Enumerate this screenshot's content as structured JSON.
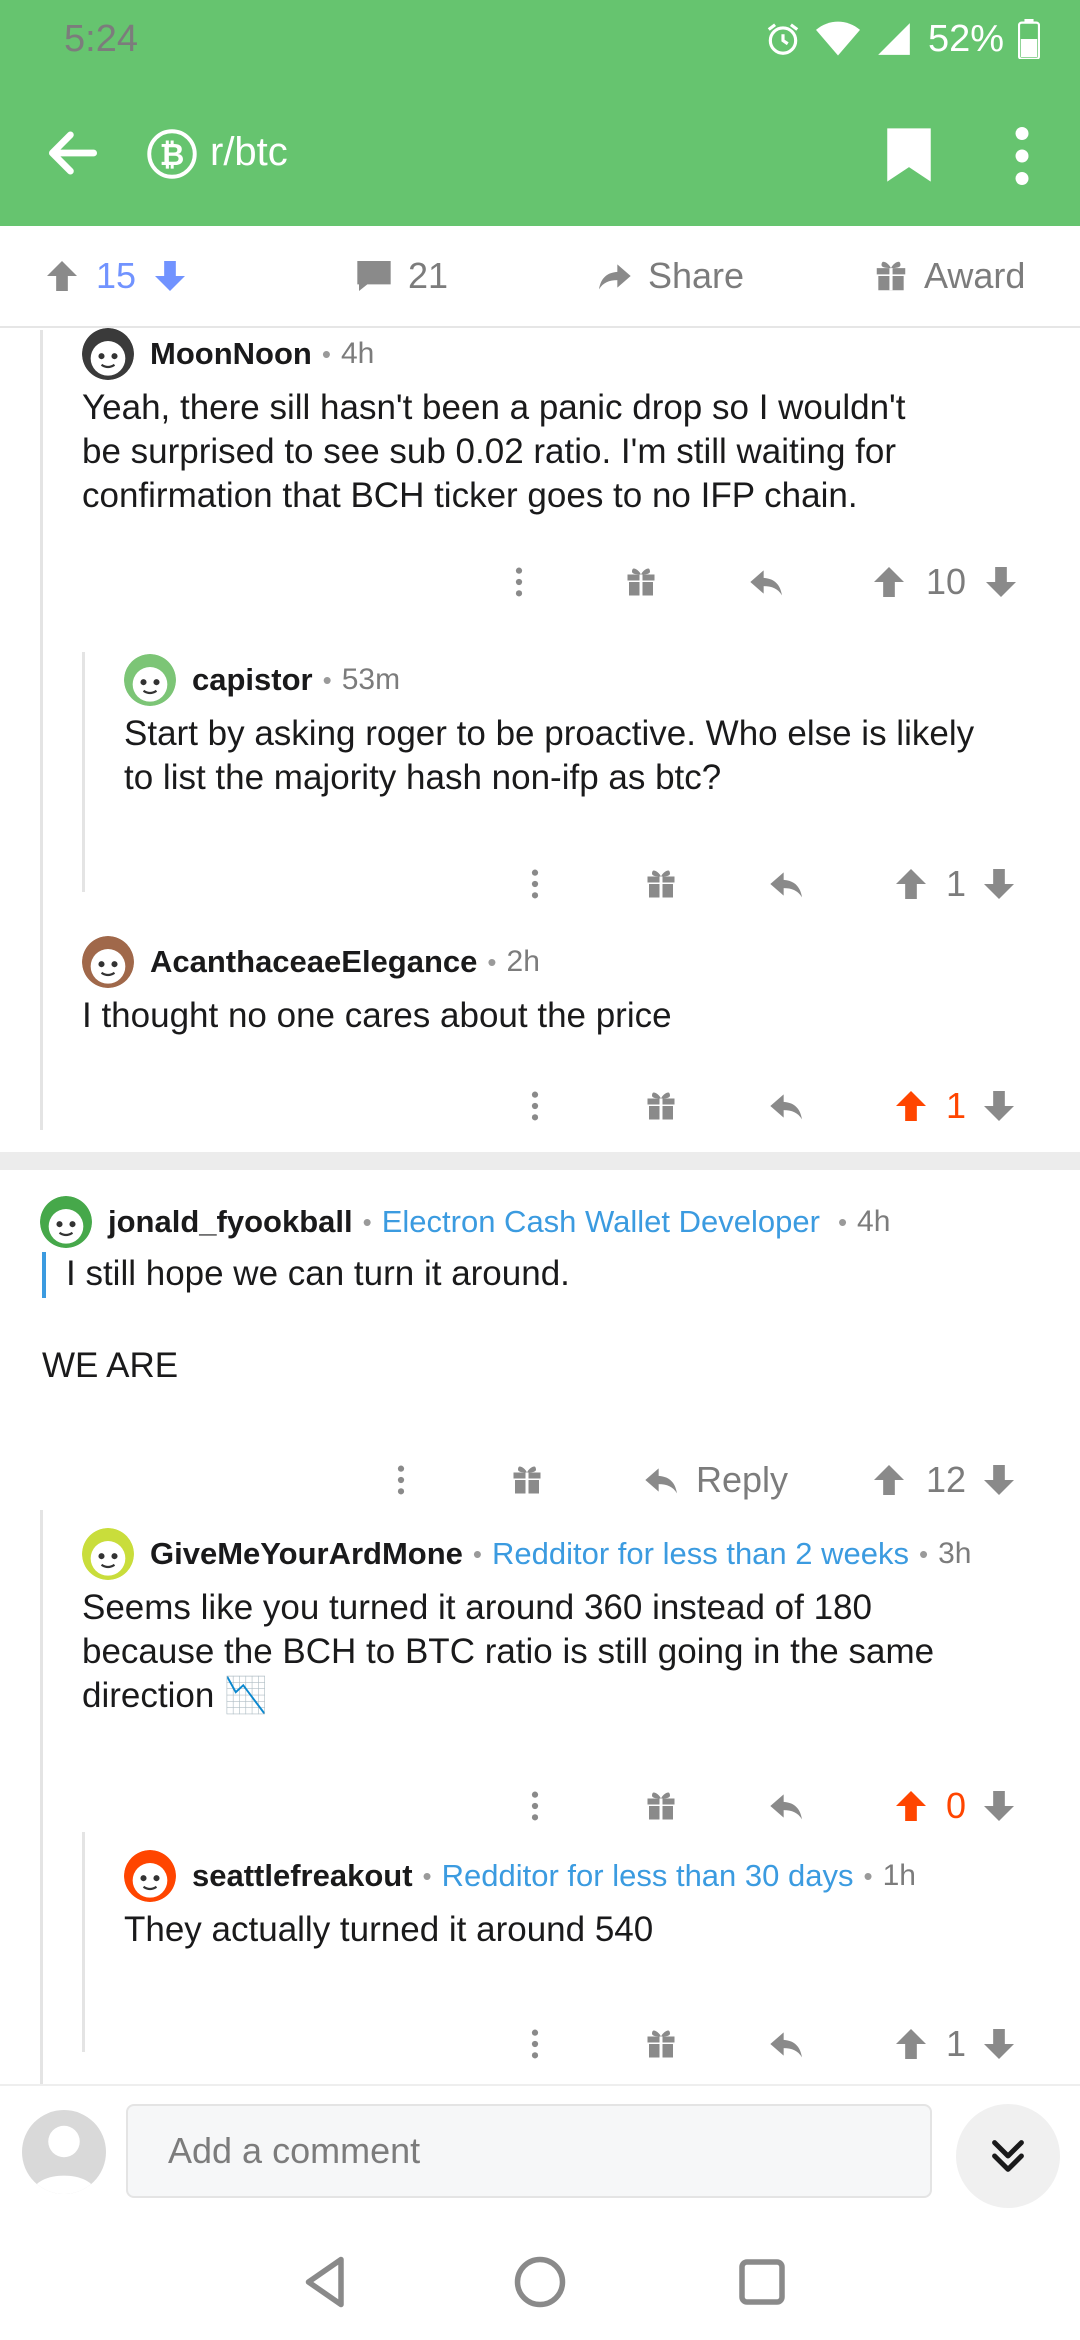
{
  "status_bar": {
    "time": "5:24",
    "battery": "52%"
  },
  "app_bar": {
    "title": "r/btc"
  },
  "post_actions": {
    "score": "15",
    "comments": "21",
    "share_label": "Share",
    "award_label": "Award"
  },
  "comments": [
    {
      "author": "MoonNoon",
      "time": "4h",
      "lines": [
        "Yeah, there sill hasn't been a panic drop so I wouldn't",
        "be surprised to see sub 0.02 ratio. I'm still waiting for",
        "confirmation that BCH ticker goes to no IFP chain."
      ],
      "score": "10"
    },
    {
      "author": "capistor",
      "time": "53m",
      "lines": [
        "Start by asking roger to be proactive. Who else is likely",
        "to list the majority hash non-ifp as btc?"
      ],
      "score": "1"
    },
    {
      "author": "AcanthaceaeElegance",
      "time": "2h",
      "lines": [
        "I thought no one cares about the price"
      ],
      "score": "1",
      "upvoted": true
    },
    {
      "author": "jonald_fyookball",
      "flair": "Electron Cash Wallet Developer",
      "time": "4h",
      "quote": "I still hope we can turn it around.",
      "lines": [
        "WE ARE"
      ],
      "reply_label": "Reply",
      "score": "12"
    },
    {
      "author": "GiveMeYourArdMone",
      "flair": "Redditor for less than 2 weeks",
      "time": "3h",
      "lines": [
        "Seems like you turned it around 360 instead of 180",
        "because the BCH to BTC ratio is still going in the same",
        "direction 📉"
      ],
      "score": "0",
      "upvoted": true
    },
    {
      "author": "seattlefreakout",
      "flair": "Redditor for less than 30 days",
      "time": "1h",
      "lines": [
        "They actually turned it around 540"
      ],
      "score": "1"
    }
  ],
  "composer": {
    "placeholder": "Add a comment"
  },
  "colors": {
    "brand_green": "#66c46f",
    "upvote_orange": "#ff4500",
    "flair_blue": "#3b9be0",
    "score_blue": "#7193ff"
  },
  "icons": [
    "back-arrow-icon",
    "bitcoin-icon",
    "bookmark-icon",
    "more-vert-icon",
    "upvote-icon",
    "downvote-icon",
    "comment-icon",
    "share-icon",
    "gift-icon",
    "reply-icon",
    "chevron-double-down-icon"
  ]
}
